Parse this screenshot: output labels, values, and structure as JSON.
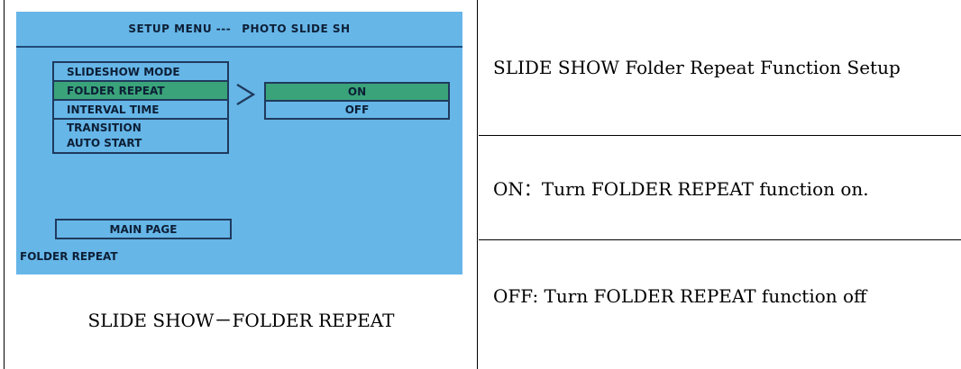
{
  "screen": {
    "header_left": "SETUP MENU ---",
    "header_right": "PHOTO SLIDE SH",
    "menu_items": [
      "SLIDESHOW MODE",
      "FOLDER REPEAT",
      "INTERVAL TIME",
      "TRANSITION",
      "AUTO START"
    ],
    "options": [
      "ON",
      "OFF"
    ],
    "main_page": "MAIN PAGE",
    "status": "FOLDER REPEAT",
    "colors": {
      "background": "#66b6e8",
      "selected": "#3aa37a",
      "border": "#1f3a5c"
    }
  },
  "caption": "SLIDE SHOW－FOLDER REPEAT",
  "descriptions": [
    "SLIDE SHOW Folder Repeat Function Setup",
    "ON：Turn FOLDER REPEAT function on.",
    "OFF: Turn FOLDER REPEAT function off"
  ]
}
